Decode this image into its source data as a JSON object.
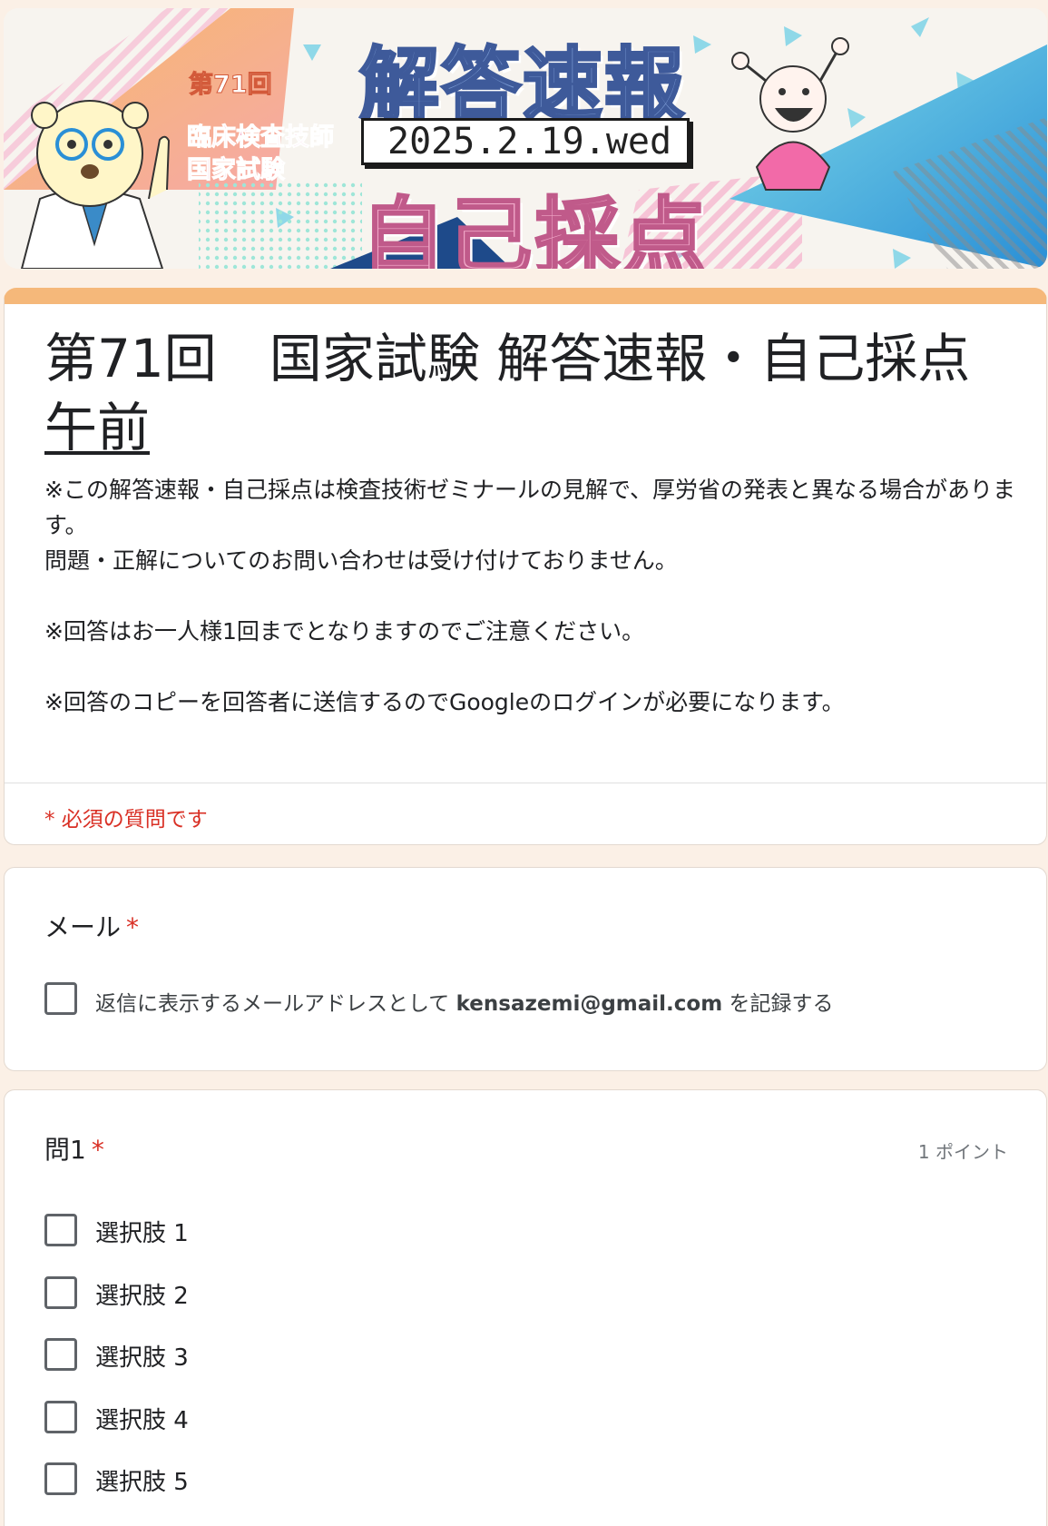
{
  "banner": {
    "round": "第71回",
    "exam_line1": "臨床検査技師",
    "exam_line2": "国家試験",
    "title": "解答速報",
    "date": "2025.2.19.wed",
    "subtitle": "自己採点"
  },
  "form": {
    "title_line1": "第71回　国家試験 解答速報・自己採点",
    "title_line2": "午前",
    "description": [
      "※この解答速報・自己採点は検査技術ゼミナールの見解で、厚労省の発表と異なる場合があります。",
      "問題・正解についてのお問い合わせは受け付けておりません。",
      "",
      "※回答はお一人様1回までとなりますのでご注意ください。",
      "",
      "※回答のコピーを回答者に送信するのでGoogleのログインが必要になります。"
    ],
    "required_note": "* 必須の質問です"
  },
  "email_question": {
    "label": "メール",
    "required_mark": "*",
    "checkbox_prefix": "返信に表示するメールアドレスとして",
    "email": "kensazemi@gmail.com",
    "checkbox_suffix": "を記録する"
  },
  "q1": {
    "label": "問1",
    "required_mark": "*",
    "points": "1 ポイント",
    "options": [
      "選択肢 1",
      "選択肢 2",
      "選択肢 3",
      "選択肢 4",
      "選択肢 5"
    ]
  },
  "colors": {
    "accent": "#f5b87a",
    "required": "#d93025",
    "background": "#fbf0e6"
  }
}
